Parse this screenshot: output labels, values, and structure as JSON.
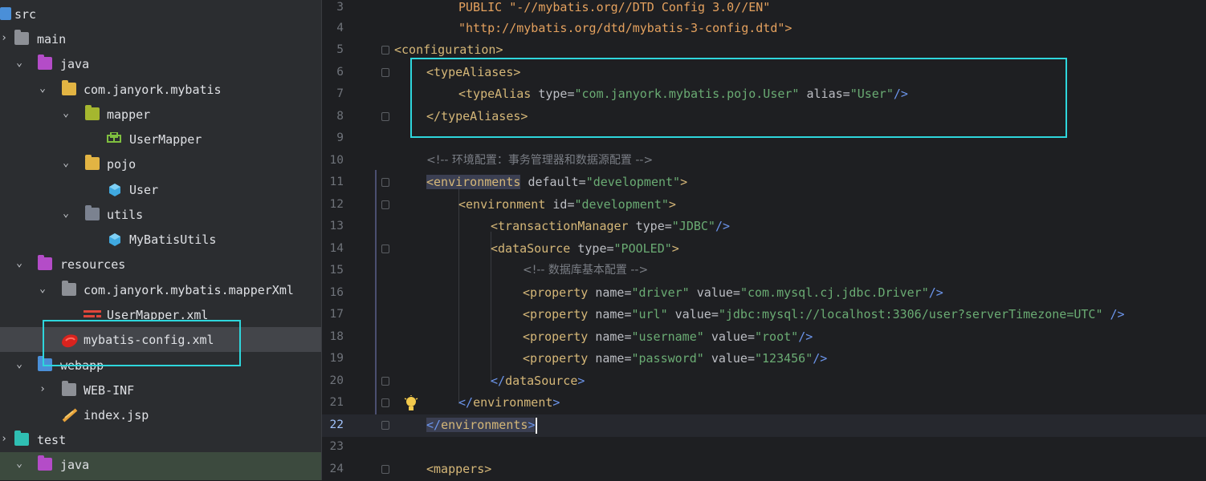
{
  "tree": {
    "items": [
      {
        "label": "src",
        "icon": "source-folder-icon"
      },
      {
        "label": "main",
        "icon": "folder-icon"
      },
      {
        "label": "java",
        "icon": "java-source-folder-icon"
      },
      {
        "label": "com.janyork.mybatis",
        "icon": "package-folder-icon"
      },
      {
        "label": "mapper",
        "icon": "package-folder-icon"
      },
      {
        "label": "UserMapper",
        "icon": "interface-icon"
      },
      {
        "label": "pojo",
        "icon": "package-folder-icon"
      },
      {
        "label": "User",
        "icon": "class-icon"
      },
      {
        "label": "utils",
        "icon": "package-folder-icon"
      },
      {
        "label": "MyBatisUtils",
        "icon": "class-icon"
      },
      {
        "label": "resources",
        "icon": "resources-folder-icon"
      },
      {
        "label": "com.janyork.mybatis.mapperXml",
        "icon": "folder-icon"
      },
      {
        "label": "UserMapper.xml",
        "icon": "xml-file-icon"
      },
      {
        "label": "mybatis-config.xml",
        "icon": "mybatis-xml-icon"
      },
      {
        "label": "webapp",
        "icon": "web-folder-icon"
      },
      {
        "label": "WEB-INF",
        "icon": "folder-icon"
      },
      {
        "label": "index.jsp",
        "icon": "jsp-file-icon"
      },
      {
        "label": "test",
        "icon": "test-folder-icon"
      },
      {
        "label": "java",
        "icon": "java-test-folder-icon"
      }
    ]
  },
  "editor": {
    "line_numbers": [
      "3",
      "4",
      "5",
      "6",
      "7",
      "8",
      "9",
      "10",
      "11",
      "12",
      "13",
      "14",
      "15",
      "16",
      "17",
      "18",
      "19",
      "20",
      "21",
      "22",
      "23",
      "24"
    ],
    "current_line": "22",
    "lines": {
      "l3": "PUBLIC \"-//mybatis.org//DTD Config 3.0//EN\"",
      "l4": "\"http://mybatis.org/dtd/mybatis-3-config.dtd\">",
      "l5_open": "<",
      "l5_tag": "configuration",
      "l5_close": ">",
      "l6_tag": "typeAliases",
      "l7_tag": "typeAlias",
      "l7_attr1": "type",
      "l7_val1": "\"com.janyork.mybatis.pojo.User\"",
      "l7_attr2": "alias",
      "l7_val2": "\"User\"",
      "l8_tag": "typeAliases",
      "l10_comment": "<!-- 环境配置：事务管理器和数据源配置 -->",
      "l11_tag": "environments",
      "l11_attr": "default",
      "l11_val": "\"development\"",
      "l12_tag": "environment",
      "l12_attr": "id",
      "l12_val": "\"development\"",
      "l13_tag": "transactionManager",
      "l13_attr": "type",
      "l13_val": "\"JDBC\"",
      "l14_tag": "dataSource",
      "l14_attr": "type",
      "l14_val": "\"POOLED\"",
      "l15_comment": "<!-- 数据库基本配置 -->",
      "prop_tag": "property",
      "name_attr": "name",
      "value_attr": "value",
      "l16_name": "\"driver\"",
      "l16_value": "\"com.mysql.cj.jdbc.Driver\"",
      "l17_name": "\"url\"",
      "l17_value": "\"jdbc:mysql://localhost:3306/user?serverTimezone=UTC\"",
      "l18_name": "\"username\"",
      "l18_value": "\"root\"",
      "l19_name": "\"password\"",
      "l19_value": "\"123456\"",
      "l20_tag": "dataSource",
      "l21_tag": "environment",
      "l22_tag": "environments",
      "l24_tag": "mappers"
    }
  },
  "colors": {
    "tree_bg": "#2b2d30",
    "editor_bg": "#1e1f22",
    "highlight_box": "#2ed6dc",
    "tag": "#d5b778",
    "string": "#6aab73",
    "comment": "#7a7e85"
  }
}
